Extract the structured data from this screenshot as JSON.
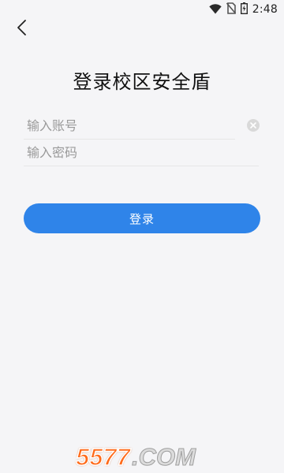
{
  "status_bar": {
    "time": "2:48",
    "icons": [
      "wifi-icon",
      "no-sim-icon",
      "battery-icon"
    ]
  },
  "header": {
    "back_icon": "chevron-left-icon",
    "title": "登录校区安全盾"
  },
  "form": {
    "account_placeholder": "输入账号",
    "account_value": "",
    "password_placeholder": "输入密码",
    "password_value": "",
    "clear_icon": "clear-circle-icon",
    "login_label": "登录"
  },
  "watermark": {
    "number": "5577",
    "domain": ".COM"
  },
  "colors": {
    "background": "#f5f5f7",
    "accent": "#2f84e9",
    "watermark_orange": "#ff6a1a"
  }
}
